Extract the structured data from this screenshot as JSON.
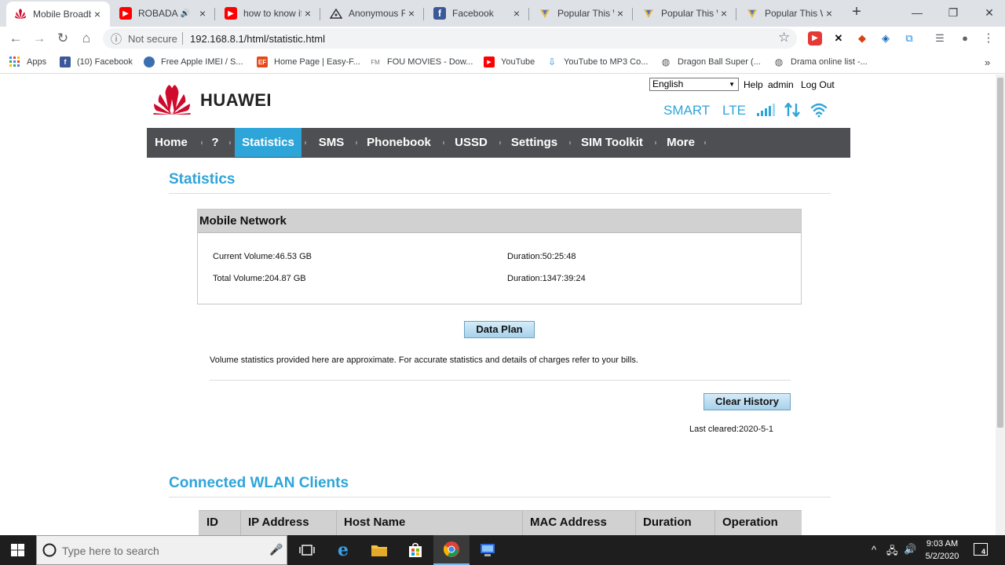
{
  "browser": {
    "tabs": [
      {
        "title": "Mobile Broadb",
        "close": "×",
        "active": true,
        "icon": "huawei-icon"
      },
      {
        "title": "ROBADA F",
        "close": "×",
        "active": false,
        "icon": "youtube-icon",
        "audio": "🔊"
      },
      {
        "title": "how to know if",
        "close": "×",
        "active": false,
        "icon": "youtube-icon"
      },
      {
        "title": "Anonymous Fil",
        "close": "×",
        "active": false,
        "icon": "anonfiles-icon"
      },
      {
        "title": "Facebook",
        "close": "×",
        "active": false,
        "icon": "facebook-icon"
      },
      {
        "title": "Popular This W",
        "close": "×",
        "active": false,
        "icon": "vpn-icon"
      },
      {
        "title": "Popular This W",
        "close": "×",
        "active": false,
        "icon": "vpn-icon"
      },
      {
        "title": "Popular This W",
        "close": "×",
        "active": false,
        "icon": "vpn-icon"
      }
    ],
    "new_tab": "+",
    "window_controls": {
      "minimize": "—",
      "maximize": "❐",
      "close": "✕"
    },
    "toolbar": {
      "back": "←",
      "forward": "→",
      "reload": "↻",
      "home": "⌂",
      "security_icon": "ⓘ",
      "security_label": "Not secure",
      "url": "192.168.8.1/html/statistic.html",
      "star": "☆",
      "menu": "⋮"
    },
    "bookmarks": [
      {
        "label": "Apps",
        "icon": "apps-grid-icon"
      },
      {
        "label": "(10) Facebook",
        "icon": "facebook-icon"
      },
      {
        "label": "Free Apple IMEI / S...",
        "icon": "apple-icon"
      },
      {
        "label": "Home Page | Easy-F...",
        "icon": "ef-icon"
      },
      {
        "label": "FOU MOVIES - Dow...",
        "icon": "fm-icon"
      },
      {
        "label": "YouTube",
        "icon": "youtube-icon"
      },
      {
        "label": "YouTube to MP3 Co...",
        "icon": "download-icon"
      },
      {
        "label": "Dragon Ball Super (...",
        "icon": "globe-icon"
      },
      {
        "label": "Drama online list -...",
        "icon": "globe-icon"
      }
    ],
    "bookmarks_overflow": "»"
  },
  "router": {
    "brand": "HUAWEI",
    "language": "English",
    "help": "Help",
    "user": "admin",
    "logout": "Log Out",
    "operator": "SMART",
    "network_type": "LTE",
    "nav": [
      "Home",
      "?",
      "Statistics",
      "SMS",
      "Phonebook",
      "USSD",
      "Settings",
      "SIM Toolkit",
      "More"
    ],
    "active_nav": "Statistics",
    "page_title": "Statistics",
    "mobile_network": {
      "heading": "Mobile Network",
      "current_volume": "Current Volume:46.53 GB",
      "current_duration": "Duration:50:25:48",
      "total_volume": "Total Volume:204.87 GB",
      "total_duration": "Duration:1347:39:24"
    },
    "data_plan_button": "Data Plan",
    "note": "Volume statistics provided here are approximate. For accurate statistics and details of charges refer to your bills.",
    "clear_history_button": "Clear History",
    "last_cleared": "Last cleared:2020-5-1",
    "wlan_title": "Connected WLAN Clients",
    "wlan_columns": [
      "ID",
      "IP Address",
      "Host Name",
      "MAC Address",
      "Duration",
      "Operation"
    ]
  },
  "taskbar": {
    "search_placeholder": "Type here to search",
    "time": "9:03 AM",
    "date": "5/2/2020",
    "notification_count": "4",
    "tray_up": "^"
  }
}
